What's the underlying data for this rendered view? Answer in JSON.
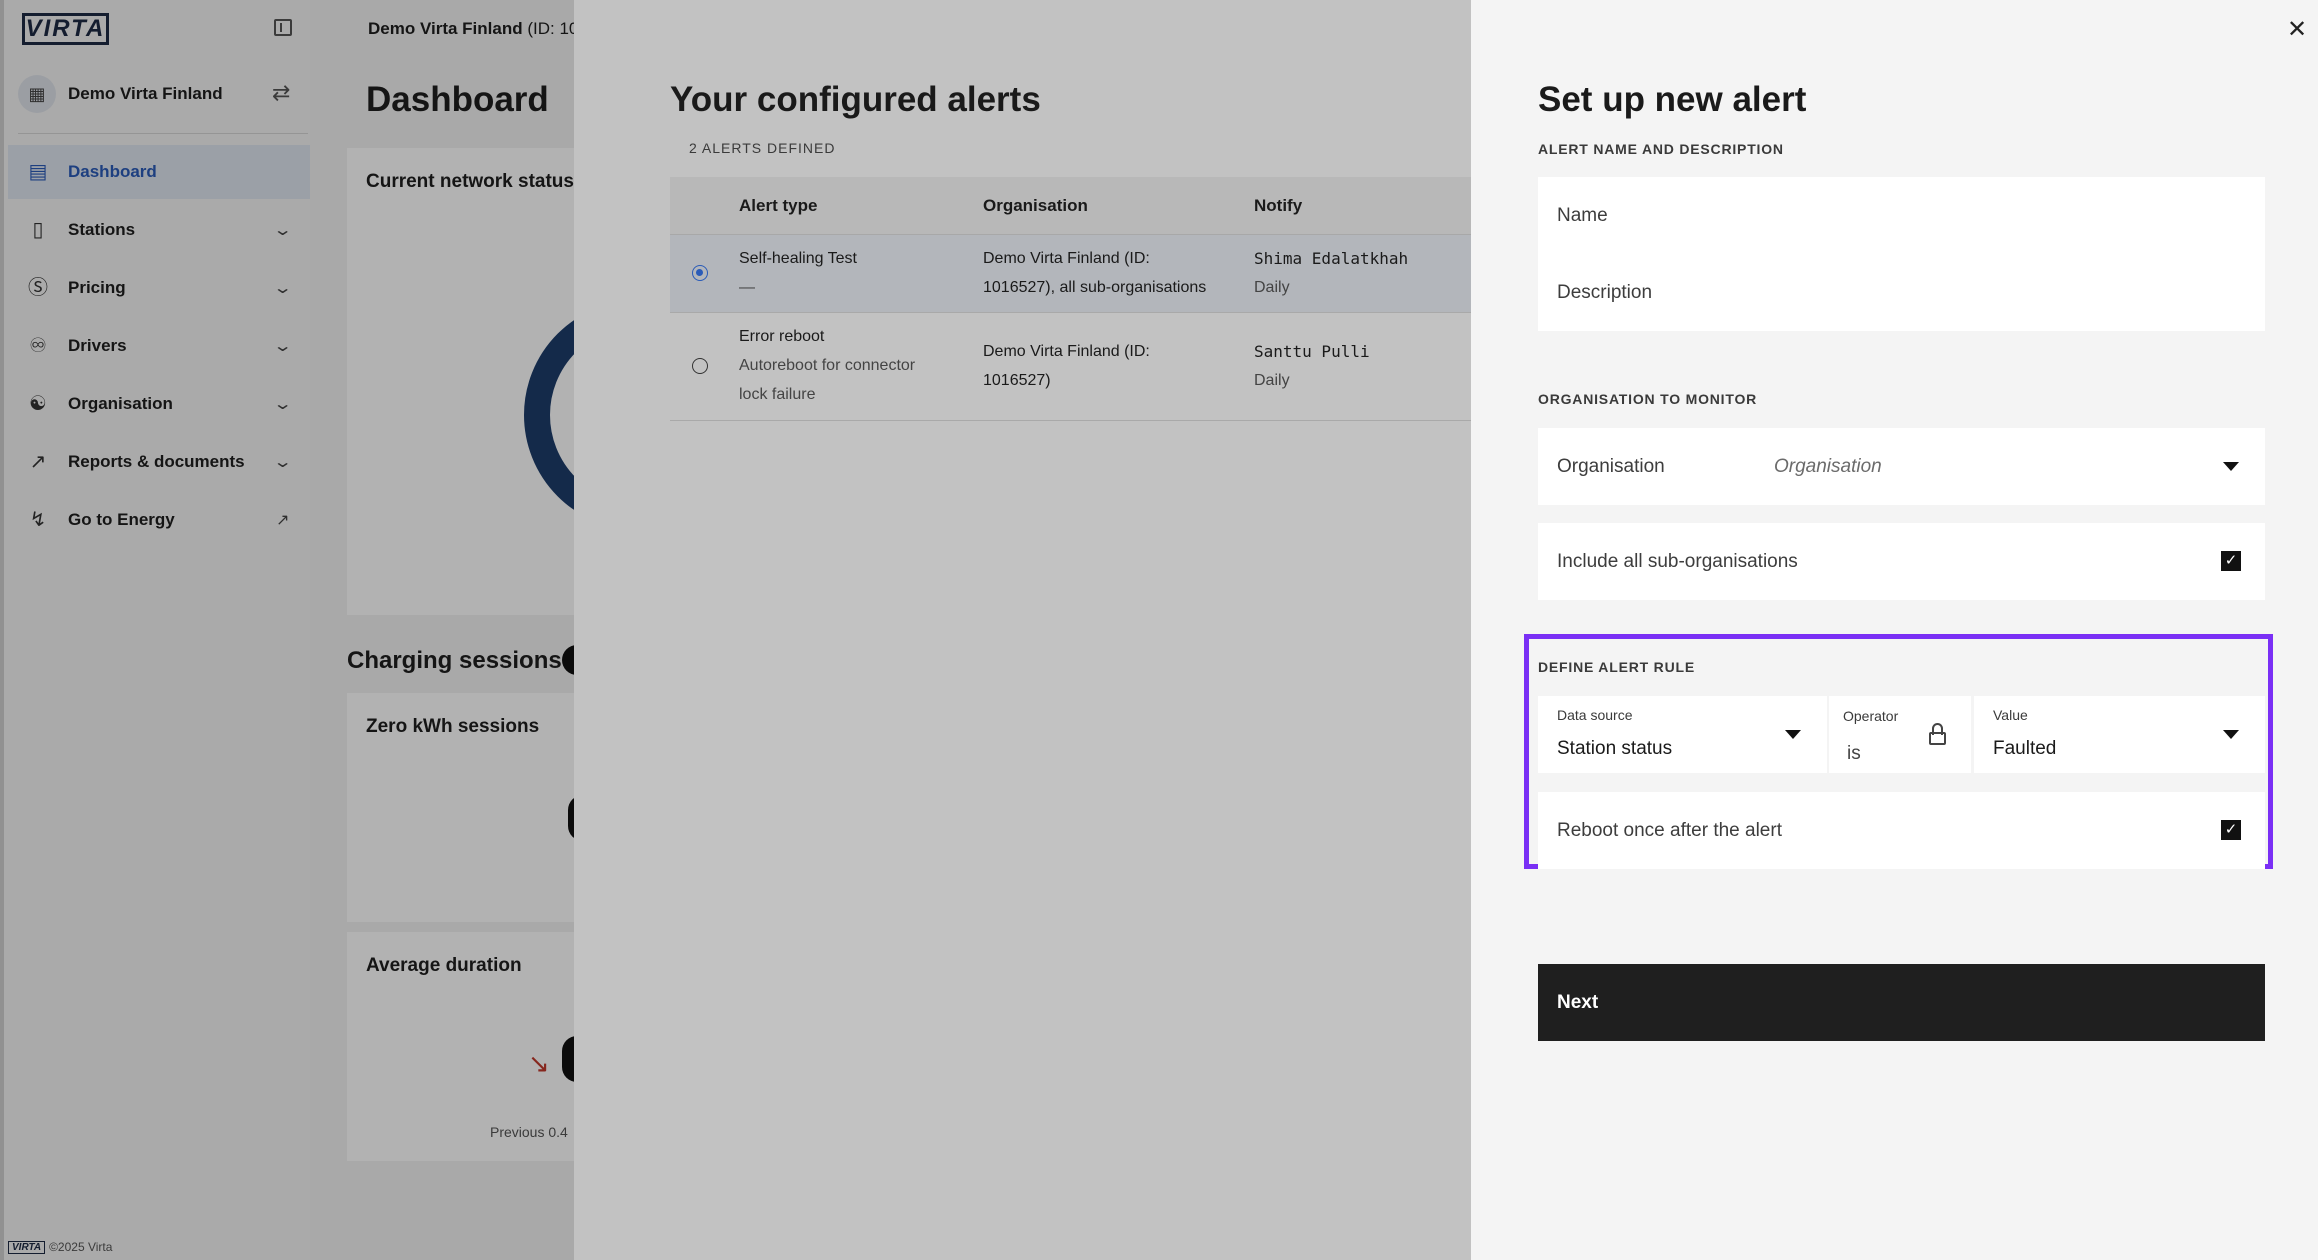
{
  "sidebar": {
    "logo": "VIRTA",
    "org_name": "Demo Virta Finland",
    "items": [
      {
        "label": "Dashboard",
        "icon": "presentation-icon",
        "active": true
      },
      {
        "label": "Stations",
        "icon": "station-icon"
      },
      {
        "label": "Pricing",
        "icon": "dollar-icon"
      },
      {
        "label": "Drivers",
        "icon": "driver-icon"
      },
      {
        "label": "Organisation",
        "icon": "organisation-icon"
      },
      {
        "label": "Reports & documents",
        "icon": "chart-line-icon"
      },
      {
        "label": "Go to Energy",
        "icon": "lightning-icon"
      }
    ],
    "footer": "©2025 Virta",
    "footer_logo": "VIRTA"
  },
  "main": {
    "breadcrumb_org": "Demo Virta Finland",
    "breadcrumb_id": "(ID: 10",
    "title": "Dashboard",
    "cards": {
      "network_status": "Current network status",
      "charging_sessions": "Charging sessions",
      "zero_kwh": "Zero kWh sessions",
      "avg_duration": "Average duration",
      "previous": "Previous 0.4"
    }
  },
  "alerts": {
    "title": "Your configured alerts",
    "count": "2 ALERTS DEFINED",
    "columns": [
      "Alert type",
      "Organisation",
      "Notify"
    ],
    "rows": [
      {
        "type": "Self-healing Test",
        "type_sub": "—",
        "org_line1": "Demo Virta Finland (ID:",
        "org_line2": "1016527), all sub-organisations",
        "notify_name": "Shima Edalatkhah",
        "notify_freq": "Daily",
        "selected": true
      },
      {
        "type": "Error reboot",
        "type_sub1": "Autoreboot for connector",
        "type_sub2": "lock failure",
        "org_line1": "Demo Virta Finland (ID:",
        "org_line2": "1016527)",
        "notify_name": "Santtu Pulli",
        "notify_freq": "Daily",
        "selected": false
      }
    ]
  },
  "new_alert": {
    "title": "Set up new alert",
    "name_section": "ALERT NAME AND DESCRIPTION",
    "name_placeholder": "Name",
    "description_placeholder": "Description",
    "org_section": "ORGANISATION TO MONITOR",
    "org_label": "Organisation",
    "org_placeholder": "Organisation",
    "include_sub_label": "Include all sub-organisations",
    "include_sub_checked": true,
    "rule_section": "DEFINE ALERT RULE",
    "data_source_label": "Data source",
    "data_source_value": "Station status",
    "operator_label": "Operator",
    "operator_value": "is",
    "value_label": "Value",
    "value_value": "Faulted",
    "reboot_label": "Reboot once after the alert",
    "reboot_checked": true,
    "next_label": "Next",
    "highlight_color": "#7a2ff5"
  }
}
